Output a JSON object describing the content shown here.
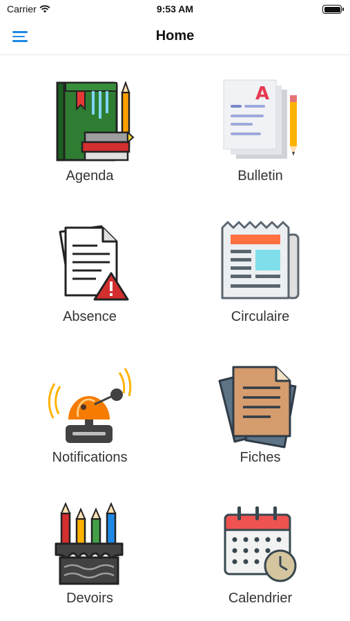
{
  "status_bar": {
    "carrier": "Carrier",
    "time": "9:53 AM"
  },
  "nav": {
    "title": "Home"
  },
  "tiles": [
    {
      "label": "Agenda",
      "icon": "books-pencil-icon"
    },
    {
      "label": "Bulletin",
      "icon": "report-pencil-icon"
    },
    {
      "label": "Absence",
      "icon": "document-warning-icon"
    },
    {
      "label": "Circulaire",
      "icon": "newspaper-icon"
    },
    {
      "label": "Notifications",
      "icon": "alarm-bell-icon"
    },
    {
      "label": "Fiches",
      "icon": "files-icon"
    },
    {
      "label": "Devoirs",
      "icon": "pencil-case-icon"
    },
    {
      "label": "Calendrier",
      "icon": "calendar-clock-icon"
    }
  ],
  "colors": {
    "accent": "#1e88e5"
  }
}
